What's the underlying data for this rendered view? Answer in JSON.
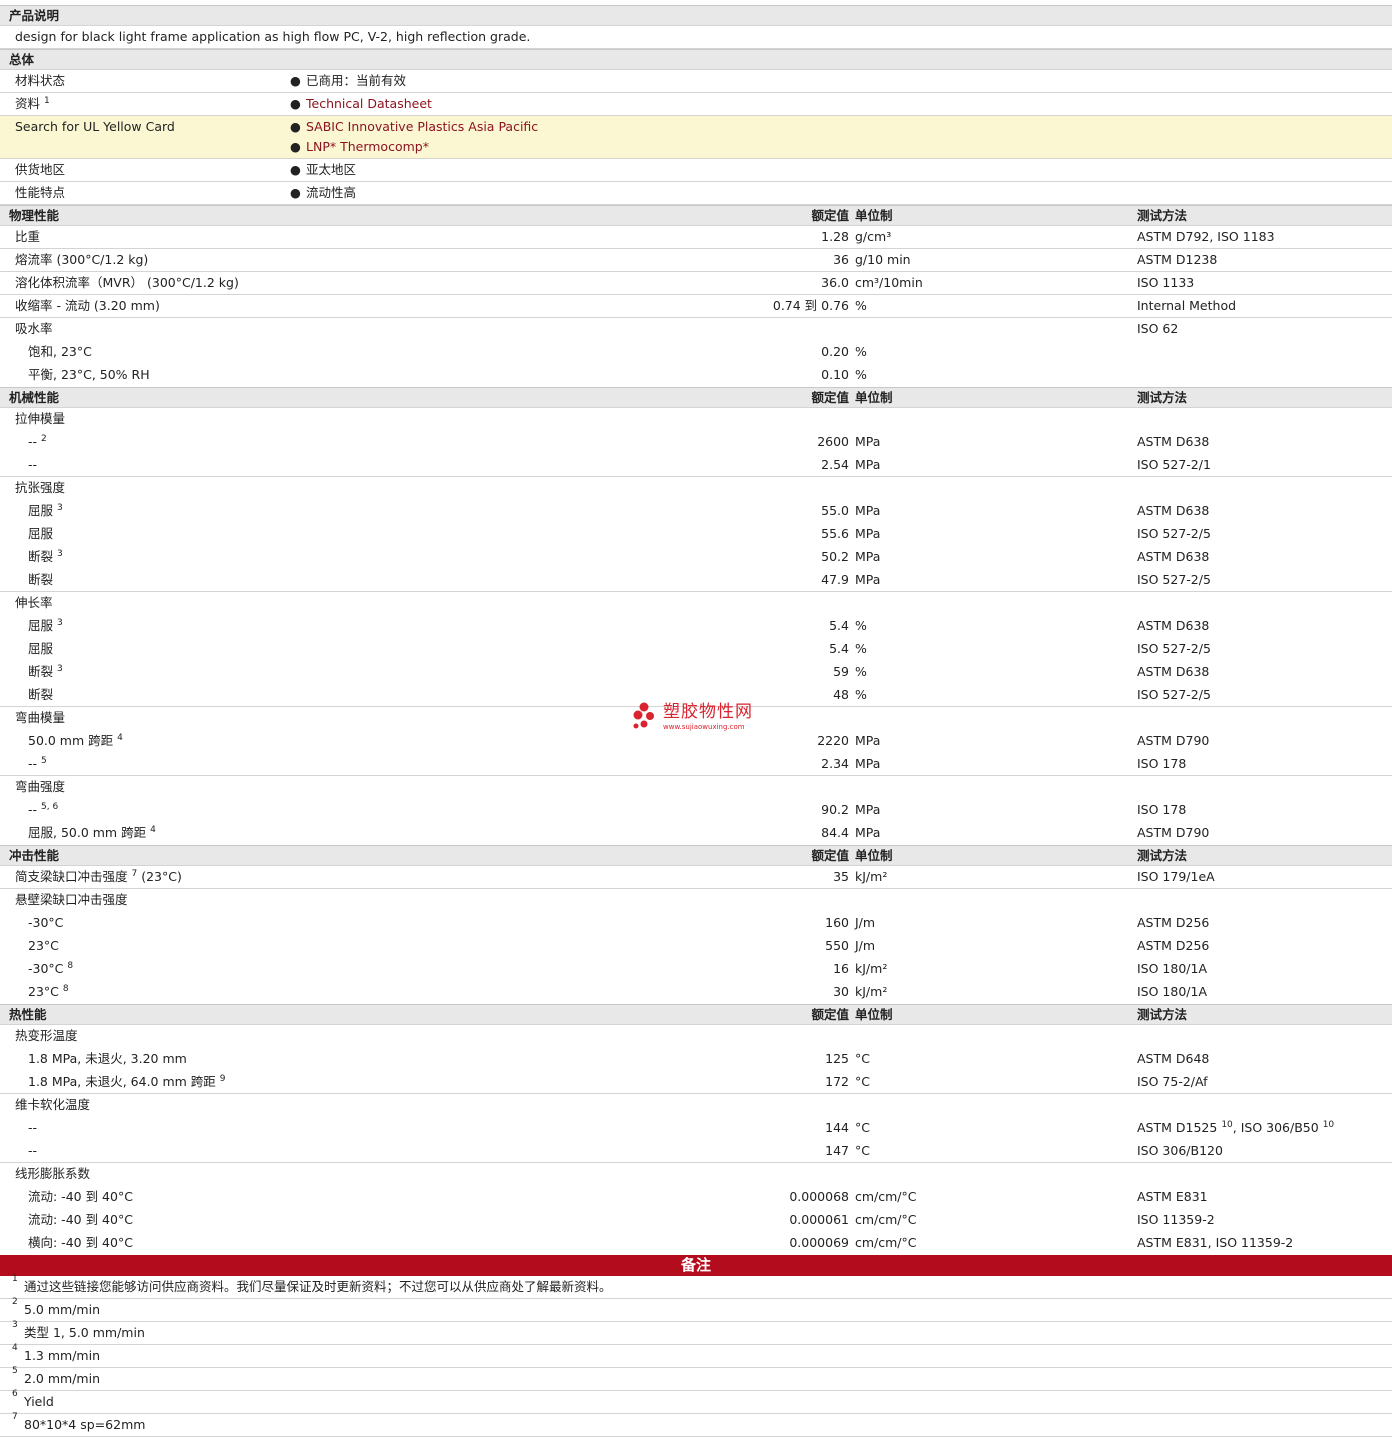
{
  "desc_header": "产品说明",
  "desc_text": "design for black light frame application as high flow PC, V-2, high reflection grade.",
  "general": {
    "header": "总体",
    "material_status_label": "材料状态",
    "material_status_value": "已商用：当前有效",
    "docs_label": "资料",
    "docs_sup": "1",
    "docs_link": "Technical Datasheet",
    "ul_label": "Search for UL Yellow Card",
    "ul_link1": "SABIC Innovative Plastics Asia Pacific",
    "ul_link2": "LNP* Thermocomp*",
    "region_label": "供货地区",
    "region_value": "亚太地区",
    "feature_label": "性能特点",
    "feature_value": "流动性高"
  },
  "col_headers": {
    "value": "额定值",
    "unit": "单位制",
    "method": "测试方法"
  },
  "physical": {
    "header": "物理性能",
    "rows": [
      {
        "label": "比重",
        "value": "1.28",
        "unit": "g/cm³",
        "method": "ASTM D792, ISO 1183"
      },
      {
        "label": "熔流率 (300°C/1.2 kg)",
        "value": "36",
        "unit": "g/10 min",
        "method": "ASTM D1238"
      },
      {
        "label": "溶化体积流率（MVR） (300°C/1.2 kg)",
        "value": "36.0",
        "unit": "cm³/10min",
        "method": "ISO 1133"
      },
      {
        "label": "收缩率 - 流动 (3.20 mm)",
        "value": "0.74 到  0.76",
        "unit": "%",
        "method": "Internal Method"
      }
    ],
    "water_label": "吸水率",
    "water_method": "ISO 62",
    "water_rows": [
      {
        "label": "饱和, 23°C",
        "value": "0.20",
        "unit": "%"
      },
      {
        "label": "平衡, 23°C, 50% RH",
        "value": "0.10",
        "unit": "%"
      }
    ]
  },
  "mechanical": {
    "header": "机械性能",
    "tensile_modulus": "拉伸模量",
    "tm1": {
      "label": "--",
      "sup": "2",
      "value": "2600",
      "unit": "MPa",
      "method": "ASTM D638"
    },
    "tm2": {
      "label": "--",
      "value": "2.54",
      "unit": "MPa",
      "method": "ISO 527-2/1"
    },
    "tensile_strength": "抗张强度",
    "ts1": {
      "label": "屈服",
      "sup": "3",
      "value": "55.0",
      "unit": "MPa",
      "method": "ASTM D638"
    },
    "ts2": {
      "label": "屈服",
      "value": "55.6",
      "unit": "MPa",
      "method": "ISO 527-2/5"
    },
    "ts3": {
      "label": "断裂",
      "sup": "3",
      "value": "50.2",
      "unit": "MPa",
      "method": "ASTM D638"
    },
    "ts4": {
      "label": "断裂",
      "value": "47.9",
      "unit": "MPa",
      "method": "ISO 527-2/5"
    },
    "elongation": "伸长率",
    "el1": {
      "label": "屈服",
      "sup": "3",
      "value": "5.4",
      "unit": "%",
      "method": "ASTM D638"
    },
    "el2": {
      "label": "屈服",
      "value": "5.4",
      "unit": "%",
      "method": "ISO 527-2/5"
    },
    "el3": {
      "label": "断裂",
      "sup": "3",
      "value": "59",
      "unit": "%",
      "method": "ASTM D638"
    },
    "el4": {
      "label": "断裂",
      "value": "48",
      "unit": "%",
      "method": "ISO 527-2/5"
    },
    "flex_modulus": "弯曲模量",
    "fm1": {
      "label": "50.0 mm 跨距",
      "sup": "4",
      "value": "2220",
      "unit": "MPa",
      "method": "ASTM D790"
    },
    "fm2": {
      "label": "--",
      "sup": "5",
      "value": "2.34",
      "unit": "MPa",
      "method": "ISO 178"
    },
    "flex_strength": "弯曲强度",
    "fs1": {
      "label": "--",
      "sup": "5, 6",
      "value": "90.2",
      "unit": "MPa",
      "method": "ISO 178"
    },
    "fs2": {
      "label": "屈服, 50.0 mm 跨距",
      "sup": "4",
      "value": "84.4",
      "unit": "MPa",
      "method": "ASTM D790"
    }
  },
  "impact": {
    "header": "冲击性能",
    "charpy": {
      "label": "简支梁缺口冲击强度",
      "sup": "7",
      "suffix": "(23°C)",
      "value": "35",
      "unit": "kJ/m²",
      "method": "ISO 179/1eA"
    },
    "izod_label": "悬壁梁缺口冲击强度",
    "iz1": {
      "label": "-30°C",
      "value": "160",
      "unit": "J/m",
      "method": "ASTM D256"
    },
    "iz2": {
      "label": "23°C",
      "value": "550",
      "unit": "J/m",
      "method": "ASTM D256"
    },
    "iz3": {
      "label": "-30°C",
      "sup": "8",
      "value": "16",
      "unit": "kJ/m²",
      "method": "ISO 180/1A"
    },
    "iz4": {
      "label": "23°C",
      "sup": "8",
      "value": "30",
      "unit": "kJ/m²",
      "method": "ISO 180/1A"
    }
  },
  "thermal": {
    "header": "热性能",
    "hdt_label": "热变形温度",
    "hdt1": {
      "label": "1.8 MPa, 未退火, 3.20 mm",
      "value": "125",
      "unit": "°C",
      "method": "ASTM D648"
    },
    "hdt2": {
      "label": "1.8 MPa, 未退火, 64.0 mm 跨距",
      "sup": "9",
      "value": "172",
      "unit": "°C",
      "method": "ISO 75-2/Af"
    },
    "vicat_label": "维卡软化温度",
    "v1": {
      "label": "--",
      "value": "144",
      "unit": "°C",
      "method_a": "ASTM D1525",
      "sup_a": "10",
      "method_b": ", ISO 306/B50",
      "sup_b": "10"
    },
    "v2": {
      "label": "--",
      "value": "147",
      "unit": "°C",
      "method": "ISO 306/B120"
    },
    "clte_label": "线形膨胀系数",
    "c1": {
      "label": "流动: -40 到  40°C",
      "value": "0.000068",
      "unit": "cm/cm/°C",
      "method": "ASTM E831"
    },
    "c2": {
      "label": "流动: -40 到  40°C",
      "value": "0.000061",
      "unit": "cm/cm/°C",
      "method": "ISO 11359-2"
    },
    "c3": {
      "label": "横向: -40 到  40°C",
      "value": "0.000069",
      "unit": "cm/cm/°C",
      "method": "ASTM E831, ISO 11359-2"
    }
  },
  "notes": {
    "title": "备注",
    "items": [
      {
        "num": "1",
        "text": "通过这些链接您能够访问供应商资料。我们尽量保证及时更新资料；不过您可以从供应商处了解最新资料。"
      },
      {
        "num": "2",
        "text": "5.0 mm/min"
      },
      {
        "num": "3",
        "text": "类型  1, 5.0 mm/min"
      },
      {
        "num": "4",
        "text": "1.3 mm/min"
      },
      {
        "num": "5",
        "text": "2.0 mm/min"
      },
      {
        "num": "6",
        "text": "Yield"
      },
      {
        "num": "7",
        "text": "80*10*4 sp=62mm"
      }
    ]
  },
  "watermark": {
    "name": "塑胶物性网",
    "url": "www.sujiaowuxing.com",
    "color": "#d9232e"
  }
}
